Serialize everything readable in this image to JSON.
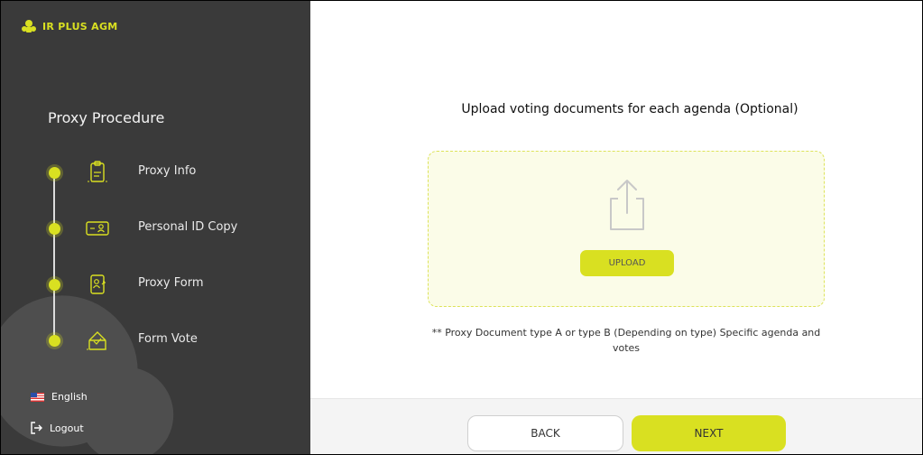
{
  "app": {
    "logo_text": "IR PLUS AGM"
  },
  "sidebar": {
    "title": "Proxy Procedure",
    "steps": [
      {
        "label": "Proxy Info",
        "icon": "clipboard-icon"
      },
      {
        "label": "Personal ID Copy",
        "icon": "id-card-icon"
      },
      {
        "label": "Proxy Form",
        "icon": "user-document-icon"
      },
      {
        "label": "Form Vote",
        "icon": "ballot-box-icon"
      }
    ],
    "language": "English",
    "logout": "Logout"
  },
  "main": {
    "heading": "Upload voting documents for each agenda (Optional)",
    "upload_label": "UPLOAD",
    "note": "** Proxy Document type A or type B (Depending on type) Specific agenda and votes"
  },
  "footer": {
    "back_label": "BACK",
    "next_label": "NEXT"
  },
  "colors": {
    "accent": "#d9e021",
    "sidebar_bg": "#3a3a3a",
    "dropzone_bg": "#fbfce8"
  }
}
